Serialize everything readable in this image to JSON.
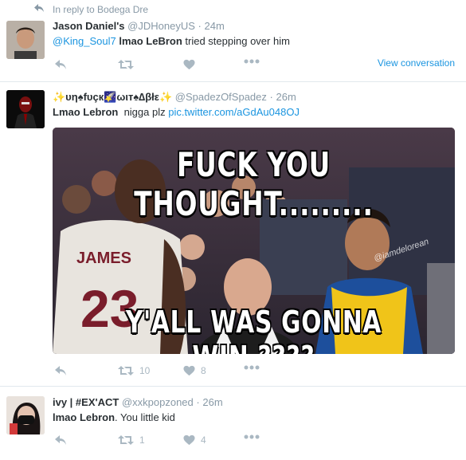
{
  "reply_context": {
    "text": "In reply to Bodega Dre"
  },
  "tweets": [
    {
      "name": "Jason Daniel's",
      "handle": "@JDHoneyUS",
      "separator": "·",
      "time": "24m",
      "mention": "@King_Soul7",
      "text_bold": "lmao LeBron",
      "text_rest": " tried stepping over him",
      "view_conversation": "View conversation"
    },
    {
      "name": "✨υη♠fυçк🌠ωιт♠∆βłε✨",
      "handle": "@SpadezOfSpadez",
      "separator": "·",
      "time": "26m",
      "text_bold": "Lmao Lebron",
      "text_rest": "  nigga plz ",
      "link": "pic.twitter.com/aGdAu048OJ",
      "retweets": "10",
      "likes": "8",
      "media": {
        "top_caption": "FUCK YOU THOUGHT.........",
        "bottom_caption": "Y'ALL WAS GONNA WIN ????",
        "jersey_name": "JAMES",
        "jersey_number": "23",
        "watermark": "@iamdelorean"
      }
    },
    {
      "name": "ivy | #EX'ACT",
      "handle": "@xxkpopzoned",
      "separator": "·",
      "time": "26m",
      "text_bold": "lmao Lebron",
      "text_rest": ". You little kid",
      "retweets": "1",
      "likes": "4"
    }
  ],
  "colors": {
    "link": "#1b95e0",
    "muted": "#8899a6",
    "icon": "#aab8c2",
    "border": "#e1e8ed"
  }
}
